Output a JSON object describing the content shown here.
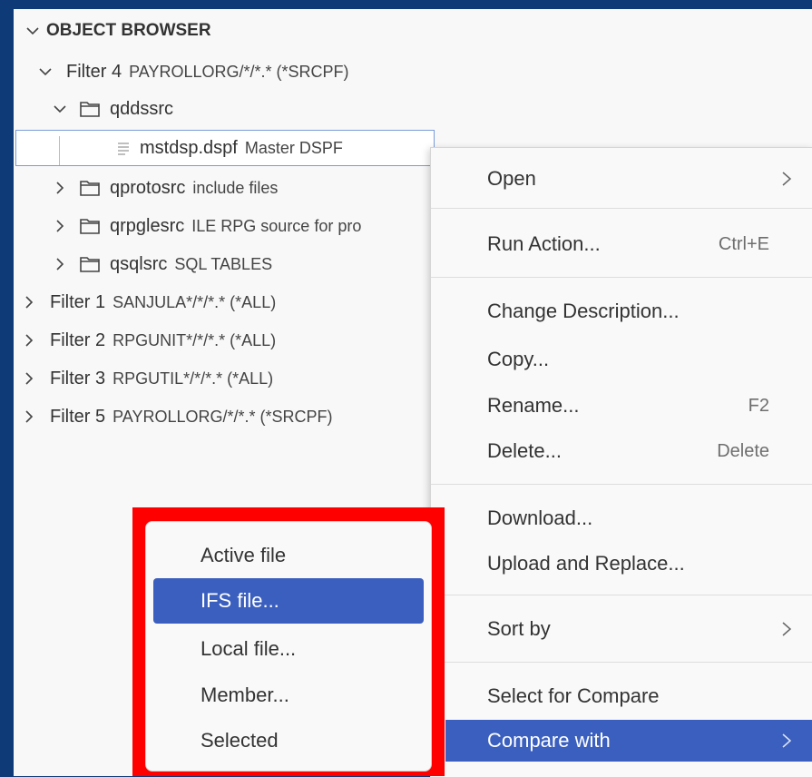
{
  "section": {
    "title": "OBJECT BROWSER"
  },
  "tree": [
    {
      "label": "Filter 4",
      "desc": "PAYROLLORG/*/*.* (*SRCPF)"
    },
    {
      "label": "qddssrc",
      "desc": ""
    },
    {
      "label": "mstdsp.dspf",
      "desc": "Master DSPF"
    },
    {
      "label": "qprotosrc",
      "desc": "include files"
    },
    {
      "label": "qrpglesrc",
      "desc": "ILE RPG source for pro"
    },
    {
      "label": "qsqlsrc",
      "desc": "SQL TABLES"
    },
    {
      "label": "Filter 1",
      "desc": "SANJULA*/*/*.* (*ALL)"
    },
    {
      "label": "Filter 2",
      "desc": "RPGUNIT*/*/*.* (*ALL)"
    },
    {
      "label": "Filter 3",
      "desc": "RPGUTIL*/*/*.* (*ALL)"
    },
    {
      "label": "Filter 5",
      "desc": "PAYROLLORG/*/*.* (*SRCPF)"
    }
  ],
  "context_menu": {
    "open": "Open",
    "run_action": "Run Action...",
    "run_action_kb": "Ctrl+E",
    "change_description": "Change Description...",
    "copy": "Copy...",
    "rename": "Rename...",
    "rename_kb": "F2",
    "delete": "Delete...",
    "delete_kb": "Delete",
    "download": "Download...",
    "upload_replace": "Upload and Replace...",
    "sort_by": "Sort by",
    "select_compare": "Select for Compare",
    "compare_with": "Compare with"
  },
  "submenu": {
    "active_file": "Active file",
    "ifs_file": "IFS file...",
    "local_file": "Local file...",
    "member": "Member...",
    "selected": "Selected"
  },
  "colors": {
    "background": "#0f3a78",
    "highlight": "#3b5fbe",
    "callout": "#ff0000"
  }
}
